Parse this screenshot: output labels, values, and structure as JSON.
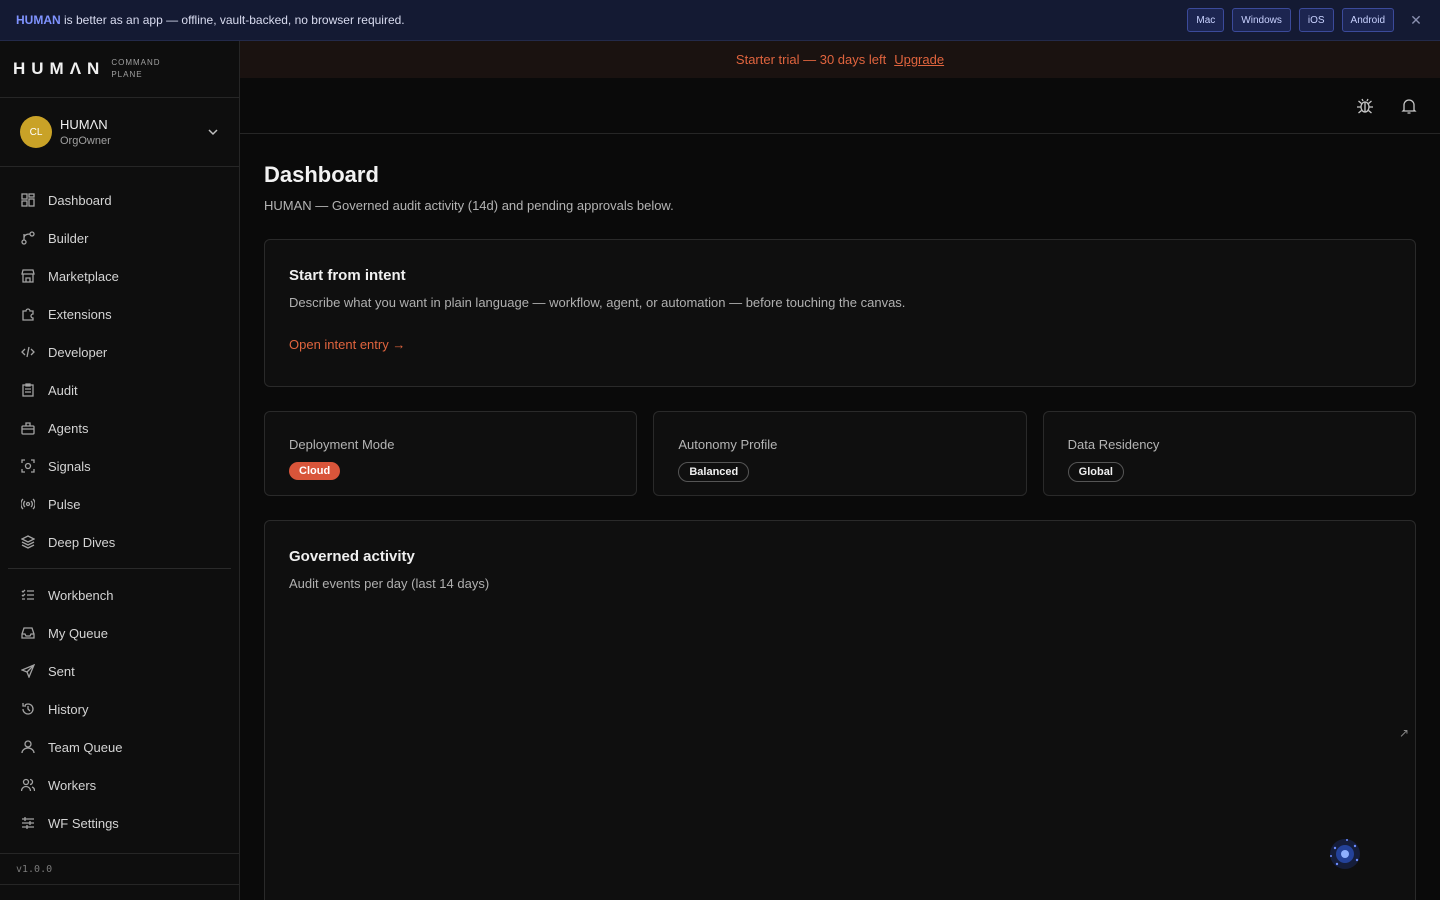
{
  "banner": {
    "brand": "HUMAN",
    "message": " is better as an app — offline, vault-backed, no browser required.",
    "platforms": [
      "Mac",
      "Windows",
      "iOS",
      "Android"
    ],
    "close_icon": "close-icon"
  },
  "sidebar": {
    "logo_word": "HUMΛN",
    "logo_sub_1": "COMMAND",
    "logo_sub_2": "PLANE",
    "org": {
      "initials": "CL",
      "name": "HUMΛN",
      "role": "OrgOwner"
    },
    "nav_primary": [
      {
        "label": "Dashboard",
        "icon": "grid-icon"
      },
      {
        "label": "Builder",
        "icon": "branch-icon"
      },
      {
        "label": "Marketplace",
        "icon": "store-icon"
      },
      {
        "label": "Extensions",
        "icon": "puzzle-icon"
      },
      {
        "label": "Developer",
        "icon": "code-icon"
      },
      {
        "label": "Audit",
        "icon": "clipboard-icon"
      },
      {
        "label": "Agents",
        "icon": "briefcase-icon"
      },
      {
        "label": "Signals",
        "icon": "scan-icon"
      },
      {
        "label": "Pulse",
        "icon": "broadcast-icon"
      },
      {
        "label": "Deep Dives",
        "icon": "layers-icon"
      }
    ],
    "nav_secondary": [
      {
        "label": "Workbench",
        "icon": "list-check-icon"
      },
      {
        "label": "My Queue",
        "icon": "inbox-icon"
      },
      {
        "label": "Sent",
        "icon": "send-icon"
      },
      {
        "label": "History",
        "icon": "history-icon"
      },
      {
        "label": "Team Queue",
        "icon": "user-icon"
      },
      {
        "label": "Workers",
        "icon": "users-icon"
      },
      {
        "label": "WF Settings",
        "icon": "sliders-icon"
      }
    ],
    "version": "v1.0.0"
  },
  "trial": {
    "text": "Starter trial — 30 days left",
    "upgrade": "Upgrade"
  },
  "main": {
    "title": "Dashboard",
    "subtitle": "HUMAN — Governed audit activity (14d) and pending approvals below.",
    "intent": {
      "title": "Start from intent",
      "desc": "Describe what you want in plain language — workflow, agent, or automation — before touching the canvas.",
      "link": "Open intent entry →"
    },
    "stats": [
      {
        "label": "Deployment Mode",
        "value": "Cloud"
      },
      {
        "label": "Autonomy Profile",
        "value": "Balanced"
      },
      {
        "label": "Data Residency",
        "value": "Global"
      }
    ],
    "activity": {
      "title": "Governed activity",
      "desc": "Audit events per day (last 14 days)"
    }
  },
  "colors": {
    "accent": "#e0643e",
    "banner_bg": "#141a33",
    "avatar": "#c9a227"
  }
}
